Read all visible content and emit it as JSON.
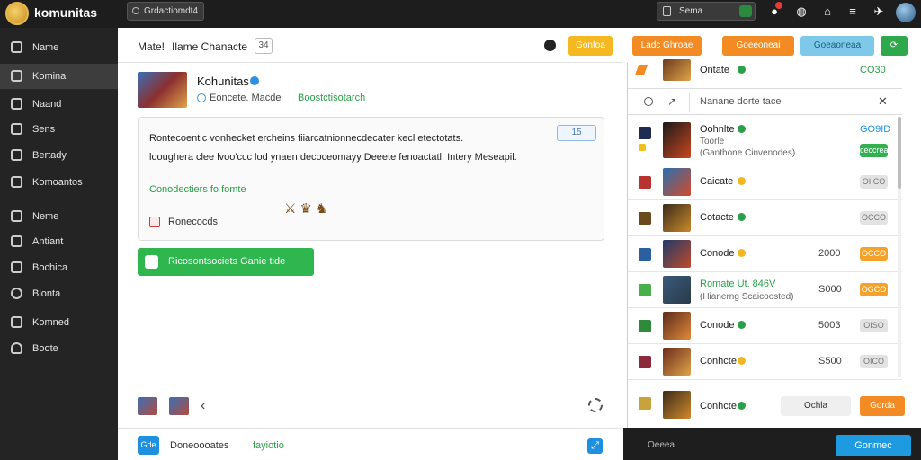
{
  "app": {
    "brand": "komunitas",
    "top_search": "Grdactiomdt4",
    "top_search2": "Sema"
  },
  "sidebar": {
    "items": [
      {
        "label": "Name",
        "active": false
      },
      {
        "label": "Komina",
        "active": true
      },
      {
        "label": "Naand",
        "active": false
      },
      {
        "label": "Sens",
        "active": false
      },
      {
        "label": "Bertady",
        "active": false
      },
      {
        "label": "Komoantos",
        "active": false
      },
      {
        "label": "Neme",
        "active": false
      },
      {
        "label": "Antiant",
        "active": false
      },
      {
        "label": "Bochica",
        "active": false
      },
      {
        "label": "Bionta",
        "active": false
      },
      {
        "label": "Komned",
        "active": false
      },
      {
        "label": "Boote",
        "active": false
      }
    ]
  },
  "header": {
    "title_a": "Mate!",
    "title_b": "Ilame Chanacte",
    "pill": "34",
    "yellow_button": "Gonfoa"
  },
  "right_header": {
    "btn1": "Ladc Ghroae",
    "btn2": "Goeeoneai",
    "btn3": "Goeaoneaa",
    "btn4": "⟳"
  },
  "content": {
    "title": "Kohunitas",
    "meta": "Eoncete. Macde",
    "meta_link": "Boostctisotarch",
    "card": {
      "line1": "Rontecoentic vonhecket ercheins fiiarcatnionnecdecater kecl etectotats.",
      "line2": "looughera clee lvoo'ccc lod ynaen decoceomayy Deeete fenoactatl. Intery Meseapil.",
      "badge": "15",
      "link": "Conodectiers fo fomte",
      "checkbox_label": "Ronecocds"
    },
    "green_bar": "Ricosontsociets Ganie tide"
  },
  "mid_footer": {},
  "bottom_bar": {
    "icon_label": "Gde",
    "text": "Doneoooates",
    "link": "fayiotio"
  },
  "rpanel": {
    "top_row": {
      "name": "Ontate",
      "value": "CO30"
    },
    "search_placeholder": "Nanane dorte tace",
    "rows": [
      {
        "name": "Oohnlte",
        "sub": "(Ganthone Cinvenodes)",
        "extra": "Toorle",
        "value": "GO9ID",
        "tag": "ceccreat",
        "tag_type": "green",
        "dot": "#2aa048"
      },
      {
        "name": "Caicate",
        "sub": "",
        "extra": "",
        "value": "",
        "tag": "OIICO",
        "tag_type": "grey",
        "dot": "#f0b820"
      },
      {
        "name": "Cotacte",
        "sub": "",
        "extra": "",
        "value": "",
        "tag": "OCCO",
        "tag_type": "grey",
        "dot": "#2aa048"
      },
      {
        "name": "Conode",
        "sub": "",
        "extra": "",
        "value": "2000",
        "tag": "OCCO",
        "tag_type": "orange",
        "dot": "#f0b820"
      },
      {
        "name": "Romate Ut. 846V",
        "sub": "(Hianerng Scaicoosted)",
        "extra": "",
        "value": "S000",
        "tag": "OGCO",
        "tag_type": "orange",
        "dot": "",
        "green_name": true
      },
      {
        "name": "Conode",
        "sub": "",
        "extra": "",
        "value": "5003",
        "tag": "OISO",
        "tag_type": "grey",
        "dot": "#2aa048"
      },
      {
        "name": "Conhcte",
        "sub": "",
        "extra": "",
        "value": "S500",
        "tag": "OICO",
        "tag_type": "grey",
        "dot": "#f0b820"
      }
    ],
    "last_row": {
      "name": "Conhcte",
      "btn_grey": "Ochla",
      "btn_orange": "Gorda"
    }
  },
  "right_bottom": {
    "label": "Oeeea",
    "cta": "Gonmec"
  }
}
